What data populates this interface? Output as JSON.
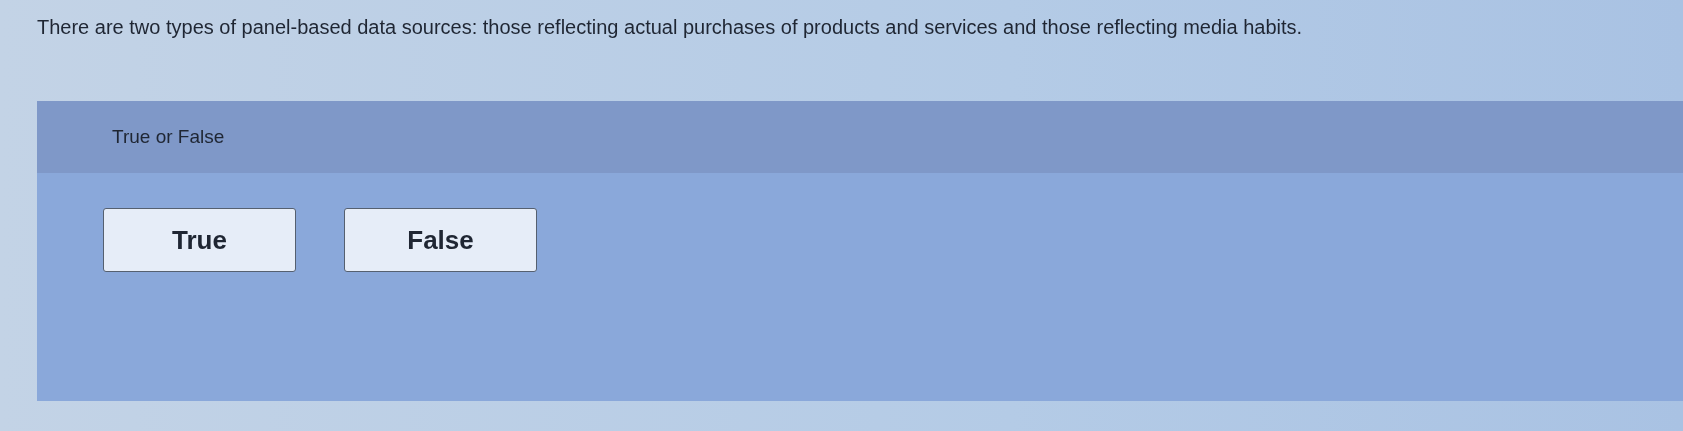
{
  "question": "There are two types of panel-based data sources: those reflecting actual purchases of products and services and those reflecting media habits.",
  "panel": {
    "header": "True or False",
    "options": [
      {
        "label": "True",
        "selected": false
      },
      {
        "label": "False",
        "selected": false
      }
    ]
  }
}
